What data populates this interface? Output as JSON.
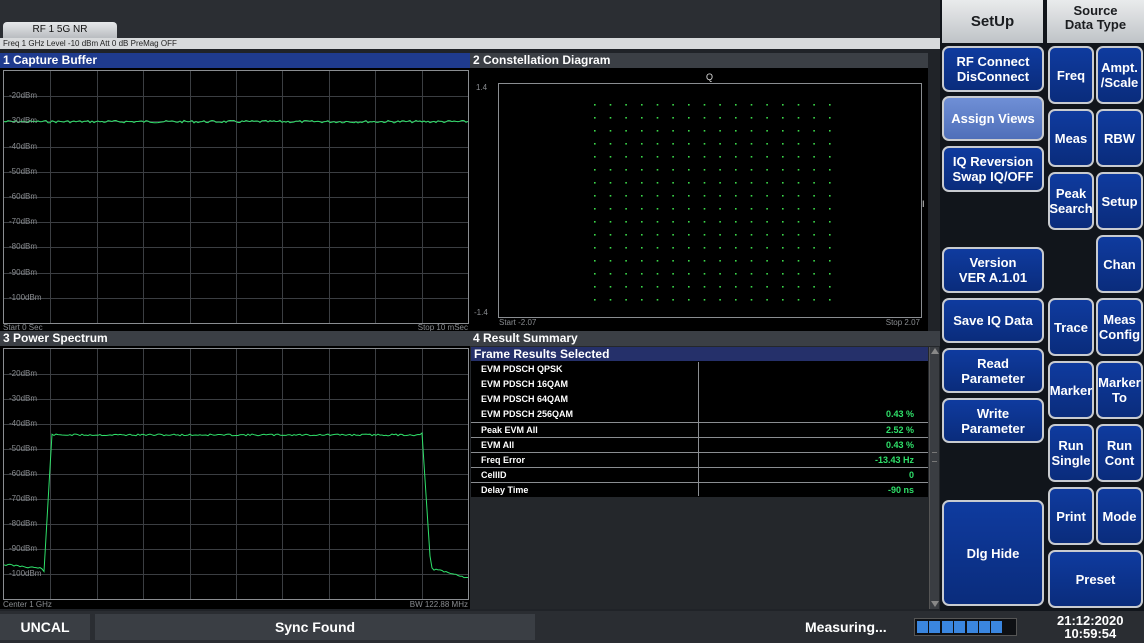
{
  "top": {
    "tab_label": "RF 1 5G NR",
    "info": "Freq 1 GHz Level -10 dBm Att 0 dB PreMag OFF"
  },
  "panels": {
    "capture": {
      "title": "1 Capture Buffer",
      "y_labels": [
        "-20dBm",
        "-30dBm",
        "-40dBm",
        "-50dBm",
        "-60dBm",
        "-70dBm",
        "-80dBm",
        "-90dBm",
        "-100dBm"
      ],
      "start": "Start 0 Sec",
      "stop": "Stop 10 mSec"
    },
    "constellation": {
      "title": "2 Constellation Diagram",
      "q_label": "Q",
      "i_label": "I",
      "y_top": "1.4",
      "y_bottom": "-1.4",
      "start": "Start -2.07",
      "stop": "Stop 2.07"
    },
    "spectrum": {
      "title": "3 Power Spectrum",
      "y_labels": [
        "-20dBm",
        "-30dBm",
        "-40dBm",
        "-50dBm",
        "-60dBm",
        "-70dBm",
        "-80dBm",
        "-90dBm",
        "-100dBm"
      ],
      "center": "Center 1 GHz",
      "bw": "BW 122.88 MHz"
    },
    "results": {
      "title": "4 Result Summary",
      "frame_header": "Frame Results Selected",
      "rows": [
        {
          "label": "EVM PDSCH QPSK",
          "value": ""
        },
        {
          "label": "EVM PDSCH 16QAM",
          "value": ""
        },
        {
          "label": "EVM PDSCH 64QAM",
          "value": ""
        },
        {
          "label": "EVM PDSCH 256QAM",
          "value": "0.43 %"
        },
        {
          "label": "Peak EVM All",
          "value": "2.52 %"
        },
        {
          "label": "EVM All",
          "value": "0.43 %"
        },
        {
          "label": "Freq Error",
          "value": "-13.43 Hz"
        },
        {
          "label": "CellID",
          "value": "0"
        },
        {
          "label": "Delay Time",
          "value": "-90 ns"
        }
      ]
    }
  },
  "right": {
    "header_left": "SetUp",
    "header_right_1": "Source",
    "header_right_2": "Data Type",
    "left_col": {
      "rf_connect": [
        "RF Connect",
        "DisConnect"
      ],
      "assign_views": "Assign Views",
      "iq_reversion": [
        "IQ Reversion",
        "Swap IQ/OFF"
      ],
      "version": [
        "Version",
        "VER A.1.01"
      ],
      "save_iq": "Save IQ Data",
      "read_param": "Read Parameter",
      "write_param": "Write Parameter",
      "dlg_hide": "Dlg Hide"
    },
    "grid": {
      "freq": "Freq",
      "ampt": [
        "Ampt.",
        "/Scale"
      ],
      "meas": "Meas",
      "rbw": "RBW",
      "peak": [
        "Peak",
        "Search"
      ],
      "setup": "Setup",
      "chan": "Chan",
      "trace": "Trace",
      "meas_config": [
        "Meas",
        "Config"
      ],
      "marker": "Marker",
      "marker_to": [
        "Marker",
        "To"
      ],
      "run_single": [
        "Run",
        "Single"
      ],
      "run_cont": [
        "Run",
        "Cont"
      ],
      "print": "Print",
      "mode": "Mode",
      "preset": "Preset"
    }
  },
  "status": {
    "uncal": "UNCAL",
    "sync": "Sync Found",
    "measuring": "Measuring...",
    "progress_segments": 8,
    "progress_filled": 7,
    "date": "21:12:2020",
    "time": "10:59:54"
  },
  "colors": {
    "trace": "#2fe06a",
    "button_blue": "#0f3b9f",
    "active_title": "#1f3b8e"
  }
}
